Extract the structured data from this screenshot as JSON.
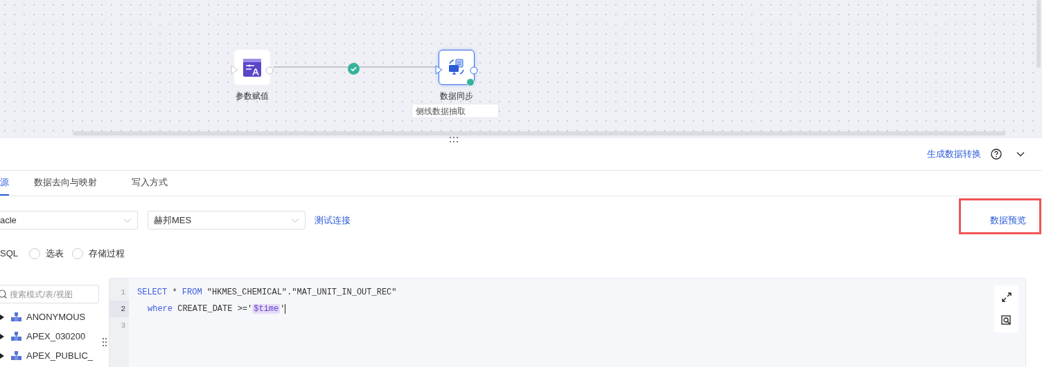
{
  "flow": {
    "nodes": [
      {
        "label": "参数赋值",
        "selected": false,
        "succeeded": false
      },
      {
        "label": "数据同步",
        "selected": true,
        "succeeded": true
      }
    ],
    "edges": [
      {
        "succeeded": true
      }
    ],
    "node_note": "侧线数据抽取"
  },
  "panel": {
    "actions": {
      "generate_link": "生成数据转换"
    },
    "tabs": [
      {
        "label": "源",
        "selected": true
      },
      {
        "label": "数据去向与映射",
        "selected": false
      },
      {
        "label": "写入方式",
        "selected": false
      }
    ],
    "source_type": "acle",
    "datasource": "赫邦MES",
    "test_link": "测试连接",
    "preview_link": "数据预览",
    "mode_label": "SQL",
    "modes": [
      {
        "label": "选表",
        "selected": false
      },
      {
        "label": "存储过程",
        "selected": false
      }
    ],
    "schema_search": {
      "placeholder": "搜索模式/表/视图"
    },
    "schemas": [
      {
        "label": "ANONYMOUS",
        "expanded": false
      },
      {
        "label": "APEX_030200",
        "expanded": false
      },
      {
        "label": "APEX_PUBLIC_",
        "expanded": false
      }
    ],
    "editor": {
      "lines": [
        {
          "number": "1",
          "active": false,
          "indented": false,
          "tokens": [
            {
              "kind": "keyword",
              "text": "SELECT"
            },
            {
              "kind": "plain",
              "text": " * "
            },
            {
              "kind": "keyword",
              "text": "FROM"
            },
            {
              "kind": "plain",
              "text": " \"HKMES_CHEMICAL\".\"MAT_UNIT_IN_OUT_REC\""
            }
          ]
        },
        {
          "number": "2",
          "active": true,
          "indented": true,
          "tokens": [
            {
              "kind": "keyword",
              "text": "where"
            },
            {
              "kind": "plain",
              "text": " CREATE_DATE >='"
            },
            {
              "kind": "variable",
              "text": "$time"
            },
            {
              "kind": "plain",
              "text": "'"
            }
          ]
        },
        {
          "number": "3",
          "active": false
        }
      ]
    }
  }
}
